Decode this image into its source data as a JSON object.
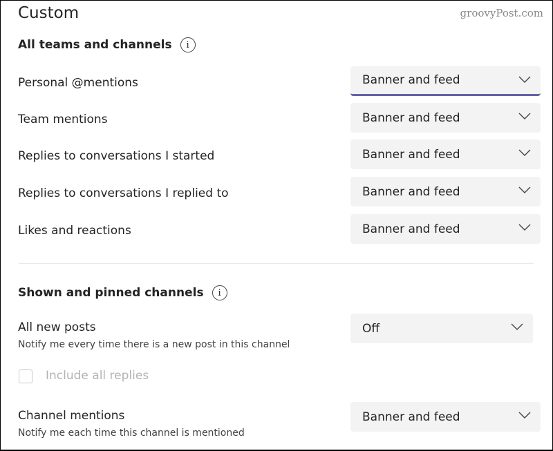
{
  "title": "Custom",
  "watermark": "groovyPost.com",
  "section1": {
    "heading": "All teams and channels",
    "rows": [
      {
        "label": "Personal @mentions",
        "value": "Banner and feed"
      },
      {
        "label": "Team mentions",
        "value": "Banner and feed"
      },
      {
        "label": "Replies to conversations I started",
        "value": "Banner and feed"
      },
      {
        "label": "Replies to conversations I replied to",
        "value": "Banner and feed"
      },
      {
        "label": "Likes and reactions",
        "value": "Banner and feed"
      }
    ]
  },
  "section2": {
    "heading": "Shown and pinned channels",
    "all_posts": {
      "label": "All new posts",
      "desc": "Notify me every time there is a new post in this channel",
      "value": "Off"
    },
    "include_replies": {
      "label": "Include all replies",
      "checked": false
    },
    "channel_mentions": {
      "label": "Channel mentions",
      "desc": "Notify me each time this channel is mentioned",
      "value": "Banner and feed"
    }
  },
  "colors": {
    "accent": "#6264a7"
  }
}
